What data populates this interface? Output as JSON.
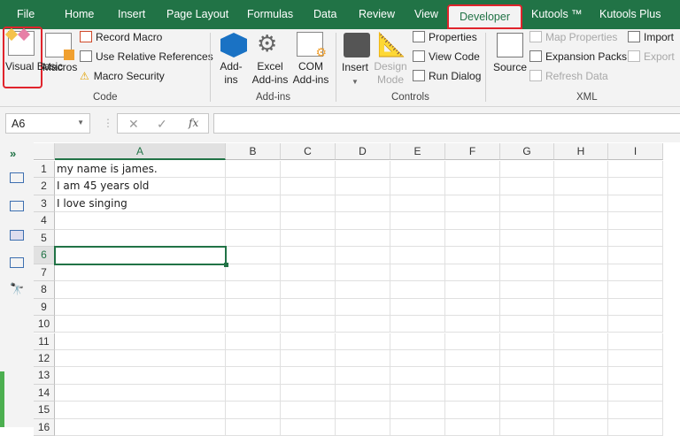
{
  "tabs": [
    "File",
    "Home",
    "Insert",
    "Page Layout",
    "Formulas",
    "Data",
    "Review",
    "View",
    "Developer",
    "Kutools ™",
    "Kutools Plus"
  ],
  "active_tab": "Developer",
  "ribbon": {
    "code": {
      "visual_basic": "Visual Basic",
      "macros": "Macros",
      "record_macro": "Record Macro",
      "use_relative": "Use Relative References",
      "macro_security": "Macro Security",
      "group": "Code"
    },
    "addins": {
      "addins": "Add-ins",
      "excel_addins": "Excel Add-ins",
      "com_addins": "COM Add-ins",
      "group": "Add-ins"
    },
    "controls": {
      "insert": "Insert",
      "design_mode": "Design Mode",
      "properties": "Properties",
      "view_code": "View Code",
      "run_dialog": "Run Dialog",
      "group": "Controls"
    },
    "xml": {
      "source": "Source",
      "map_properties": "Map Properties",
      "expansion_packs": "Expansion Packs",
      "refresh_data": "Refresh Data",
      "import": "Import",
      "export": "Export",
      "group": "XML"
    }
  },
  "formula_bar": {
    "name_box": "A6",
    "cancel": "✕",
    "enter": "✓",
    "fx": "fx",
    "value": ""
  },
  "columns": [
    "A",
    "B",
    "C",
    "D",
    "E",
    "F",
    "G",
    "H",
    "I"
  ],
  "rows": [
    {
      "n": "1",
      "A": " my name is james."
    },
    {
      "n": "2",
      "A": "I am 45 years old"
    },
    {
      "n": "3",
      "A": "I love singing"
    },
    {
      "n": "4"
    },
    {
      "n": "5"
    },
    {
      "n": "6"
    },
    {
      "n": "7"
    },
    {
      "n": "8"
    },
    {
      "n": "9"
    },
    {
      "n": "10"
    },
    {
      "n": "11"
    },
    {
      "n": "12"
    },
    {
      "n": "13"
    },
    {
      "n": "14"
    },
    {
      "n": "15"
    },
    {
      "n": "16"
    }
  ],
  "selected_cell": "A6",
  "colors": {
    "brand": "#217346",
    "highlight": "#e0242c"
  }
}
